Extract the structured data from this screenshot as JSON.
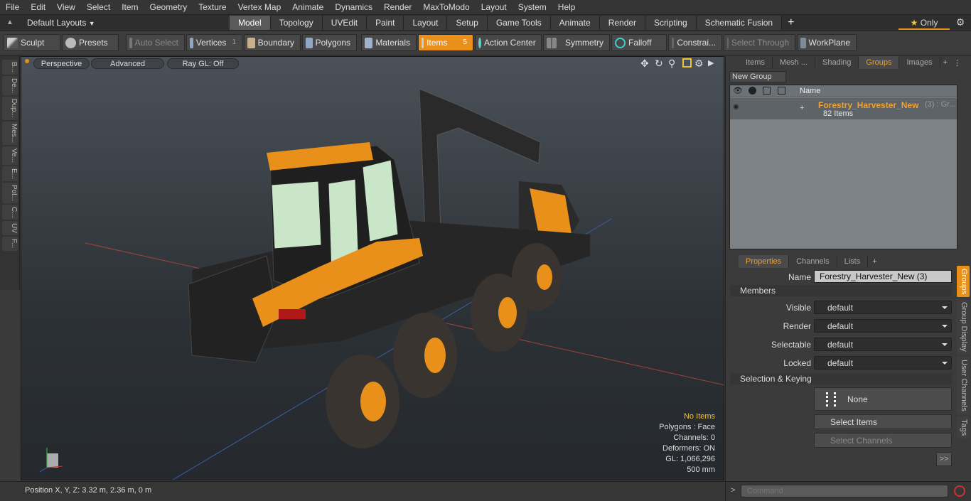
{
  "menu": [
    "File",
    "Edit",
    "View",
    "Select",
    "Item",
    "Geometry",
    "Texture",
    "Vertex Map",
    "Animate",
    "Dynamics",
    "Render",
    "MaxToModo",
    "Layout",
    "System",
    "Help"
  ],
  "layoutbar": {
    "preset": "Default Layouts",
    "tabs": [
      "Model",
      "Topology",
      "UVEdit",
      "Paint",
      "Layout",
      "Setup",
      "Game Tools",
      "Animate",
      "Render",
      "Scripting",
      "Schematic Fusion"
    ],
    "active_tab": "Model",
    "add": "+",
    "only_label": "Only"
  },
  "toolbar": {
    "sculpt": "Sculpt",
    "presets": "Presets",
    "auto_select": "Auto Select",
    "vertices": "Vertices",
    "vertices_count": "1",
    "boundary": "Boundary",
    "polygons": "Polygons",
    "materials": "Materials",
    "items": "Items",
    "items_count": "5",
    "action_center": "Action Center",
    "symmetry": "Symmetry",
    "falloff": "Falloff",
    "constraints": "Constrai...",
    "select_through": "Select Through",
    "workplane": "WorkPlane"
  },
  "lefttabs": [
    "B...",
    "De...",
    "Dup...",
    "Mes...",
    "Ve...",
    "E...",
    "Pol...",
    "C...",
    "UV",
    "F..."
  ],
  "viewport": {
    "view": "Perspective",
    "shading": "Advanced",
    "raygl": "Ray GL: Off",
    "hud": {
      "selection": "No Items",
      "polygons": "Polygons : Face",
      "channels": "Channels: 0",
      "deformers": "Deformers: ON",
      "gl": "GL: 1,066,296",
      "scale": "500 mm"
    }
  },
  "status": {
    "position": "Position X, Y, Z:  3.32 m, 2.36 m, 0 m"
  },
  "rightpanel": {
    "top_tabs": [
      "Items",
      "Mesh ...",
      "Shading",
      "Groups",
      "Images"
    ],
    "active_top": "Groups",
    "new_group": "New Group",
    "name_header": "Name",
    "group": {
      "name": "Forestry_Harvester_New",
      "suffix": "(3) : Gr...",
      "count": "82 Items"
    },
    "prop_tabs": [
      "Properties",
      "Channels",
      "Lists"
    ],
    "active_prop": "Properties",
    "name_label": "Name",
    "name_value": "Forestry_Harvester_New (3)",
    "members_header": "Members",
    "fields": [
      {
        "label": "Visible",
        "value": "default"
      },
      {
        "label": "Render",
        "value": "default"
      },
      {
        "label": "Selectable",
        "value": "default"
      },
      {
        "label": "Locked",
        "value": "default"
      }
    ],
    "sel_header": "Selection & Keying",
    "none_btn": "None",
    "select_items": "Select Items",
    "select_channels": "Select Channels",
    "more": ">>",
    "side_tabs": [
      "Groups",
      "Group Display",
      "User Channels",
      "Tags"
    ],
    "command_placeholder": "Command"
  },
  "colors": {
    "accent": "#e8901a",
    "highlight": "#f0a030",
    "hud_yellow": "#f0c23a"
  }
}
